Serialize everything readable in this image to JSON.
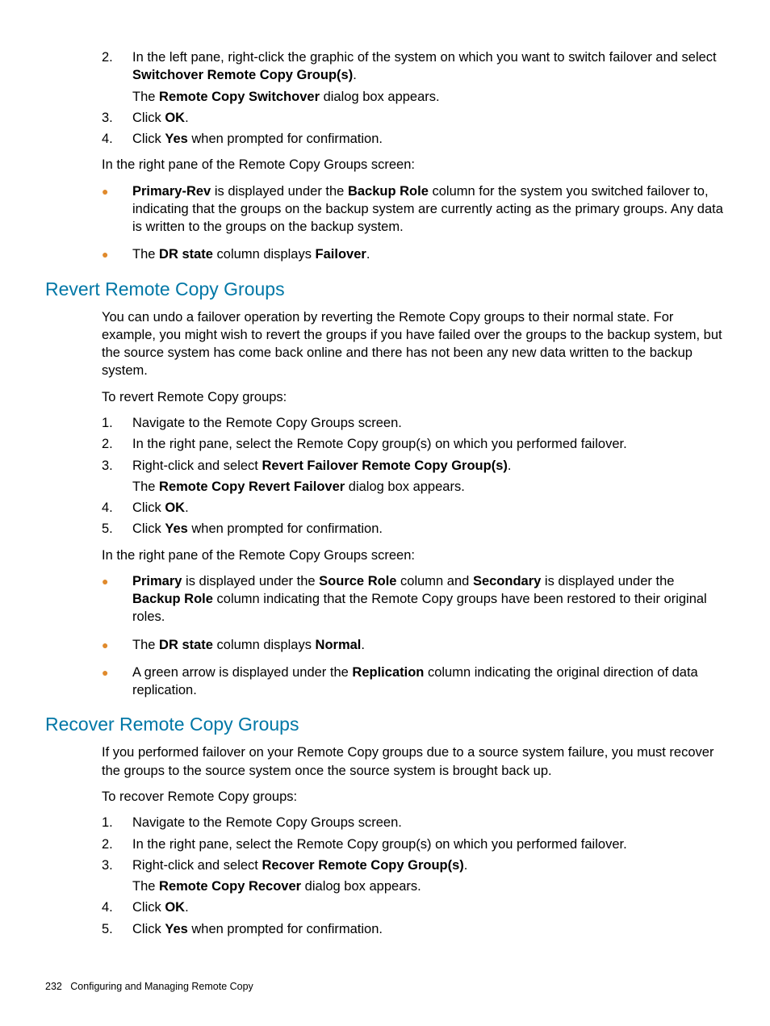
{
  "top_steps": [
    {
      "num": "2.",
      "html": "In the left pane, right-click the graphic of the system on which you want to switch failover and select <b>Switchover Remote Copy Group(s)</b>.",
      "sub_html": "The <b>Remote Copy Switchover</b> dialog box appears."
    },
    {
      "num": "3.",
      "html": "Click <b>OK</b>."
    },
    {
      "num": "4.",
      "html": "Click <b>Yes</b> when prompted for confirmation."
    }
  ],
  "top_follow": "In the right pane of the Remote Copy Groups screen:",
  "top_bullets": [
    "<b>Primary-Rev</b> is displayed under the <b>Backup Role</b> column for the system you switched failover to, indicating that the groups on the backup system are currently acting as the primary groups. Any data is written to the groups on the backup system.",
    "The <b>DR state</b> column displays <b>Failover</b>."
  ],
  "revert": {
    "heading": "Revert Remote Copy Groups",
    "intro": "You can undo a failover operation by reverting the Remote Copy groups to their normal state. For example, you might wish to revert the groups if you have failed over the groups to the backup system, but the source system has come back online and there has not been any new data written to the backup system.",
    "lead": "To revert Remote Copy groups:",
    "steps": [
      {
        "num": "1.",
        "html": "Navigate to the Remote Copy Groups screen."
      },
      {
        "num": "2.",
        "html": "In the right pane, select the Remote Copy group(s) on which you performed failover."
      },
      {
        "num": "3.",
        "html": "Right-click and select <b>Revert Failover Remote Copy Group(s)</b>.",
        "sub_html": "The <b>Remote Copy Revert Failover</b> dialog box appears."
      },
      {
        "num": "4.",
        "html": "Click <b>OK</b>."
      },
      {
        "num": "5.",
        "html": "Click <b>Yes</b> when prompted for confirmation."
      }
    ],
    "follow": "In the right pane of the Remote Copy Groups screen:",
    "bullets": [
      "<b>Primary</b> is displayed under the <b>Source Role</b> column and <b>Secondary</b> is displayed under the <b>Backup Role</b> column indicating that the Remote Copy groups have been restored to their original roles.",
      "The <b>DR state</b> column displays <b>Normal</b>.",
      "A green arrow is displayed under the <b>Replication</b> column indicating the original direction of data replication."
    ]
  },
  "recover": {
    "heading": "Recover Remote Copy Groups",
    "intro": "If you performed failover on your Remote Copy groups due to a source system failure, you must recover the groups to the source system once the source system is brought back up.",
    "lead": "To recover Remote Copy groups:",
    "steps": [
      {
        "num": "1.",
        "html": "Navigate to the Remote Copy Groups screen."
      },
      {
        "num": "2.",
        "html": "In the right pane, select the Remote Copy group(s) on which you performed failover."
      },
      {
        "num": "3.",
        "html": "Right-click and select <b>Recover Remote Copy Group(s)</b>.",
        "sub_html": "The <b>Remote Copy Recover</b> dialog box appears."
      },
      {
        "num": "4.",
        "html": "Click <b>OK</b>."
      },
      {
        "num": "5.",
        "html": "Click <b>Yes</b> when prompted for confirmation."
      }
    ]
  },
  "footer": {
    "page": "232",
    "title": "Configuring and Managing Remote Copy"
  }
}
